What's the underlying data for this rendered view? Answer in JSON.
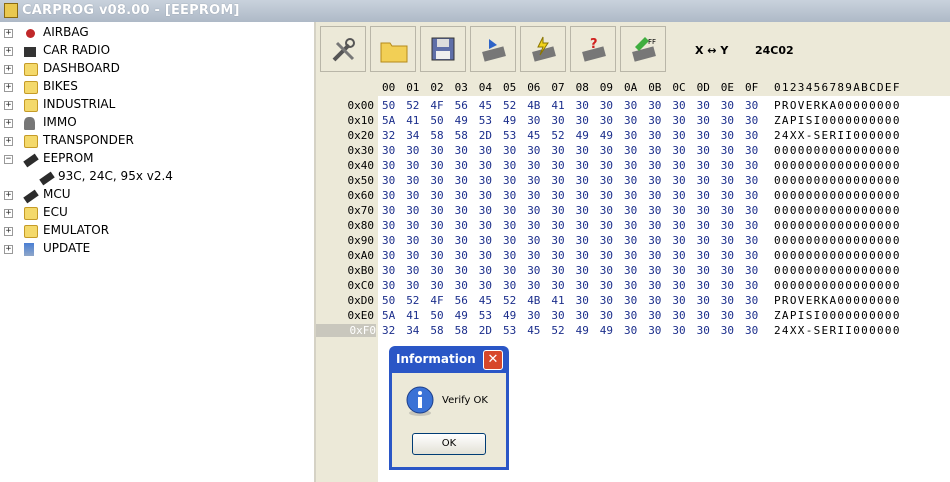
{
  "window": {
    "title": "CARPROG   v08.00 - [EEPROM]"
  },
  "tree": {
    "items": [
      {
        "label": "AIRBAG",
        "icon": "airbag-icon",
        "expand": "+"
      },
      {
        "label": "CAR RADIO",
        "icon": "radio-icon",
        "expand": "+"
      },
      {
        "label": "DASHBOARD",
        "icon": "folder-icon",
        "expand": "+"
      },
      {
        "label": "BIKES",
        "icon": "folder-icon",
        "expand": "+"
      },
      {
        "label": "INDUSTRIAL",
        "icon": "folder-icon",
        "expand": "+"
      },
      {
        "label": "IMMO",
        "icon": "immo-icon",
        "expand": "+"
      },
      {
        "label": "TRANSPONDER",
        "icon": "folder-icon",
        "expand": "+"
      },
      {
        "label": "EEPROM",
        "icon": "chip-icon",
        "expand": "−"
      },
      {
        "label": "93C, 24C, 95x v2.4",
        "icon": "chip-icon",
        "child": true
      },
      {
        "label": "MCU",
        "icon": "chip-icon",
        "expand": "+"
      },
      {
        "label": "ECU",
        "icon": "folder-icon",
        "expand": "+"
      },
      {
        "label": "EMULATOR",
        "icon": "folder-icon",
        "expand": "+"
      },
      {
        "label": "UPDATE",
        "icon": "update-icon",
        "expand": "+"
      }
    ]
  },
  "toolbar": {
    "buttons": [
      "settings-tools",
      "open-folder",
      "save-file",
      "read-chip",
      "write-chip",
      "verify-chip",
      "erase-chip"
    ],
    "swap_label": "X ↔ Y",
    "chip_label": "24C02"
  },
  "hex": {
    "columns": [
      "00",
      "01",
      "02",
      "03",
      "04",
      "05",
      "06",
      "07",
      "08",
      "09",
      "0A",
      "0B",
      "0C",
      "0D",
      "0E",
      "0F"
    ],
    "ascii_header": "0123456789ABCDEF",
    "rows": [
      {
        "addr": "0x00",
        "bytes": [
          "50",
          "52",
          "4F",
          "56",
          "45",
          "52",
          "4B",
          "41",
          "30",
          "30",
          "30",
          "30",
          "30",
          "30",
          "30",
          "30"
        ],
        "ascii": "PROVERKA00000000"
      },
      {
        "addr": "0x10",
        "bytes": [
          "5A",
          "41",
          "50",
          "49",
          "53",
          "49",
          "30",
          "30",
          "30",
          "30",
          "30",
          "30",
          "30",
          "30",
          "30",
          "30"
        ],
        "ascii": "ZAPISI0000000000"
      },
      {
        "addr": "0x20",
        "bytes": [
          "32",
          "34",
          "58",
          "58",
          "2D",
          "53",
          "45",
          "52",
          "49",
          "49",
          "30",
          "30",
          "30",
          "30",
          "30",
          "30"
        ],
        "ascii": "24XX-SERII000000"
      },
      {
        "addr": "0x30",
        "bytes": [
          "30",
          "30",
          "30",
          "30",
          "30",
          "30",
          "30",
          "30",
          "30",
          "30",
          "30",
          "30",
          "30",
          "30",
          "30",
          "30"
        ],
        "ascii": "0000000000000000"
      },
      {
        "addr": "0x40",
        "bytes": [
          "30",
          "30",
          "30",
          "30",
          "30",
          "30",
          "30",
          "30",
          "30",
          "30",
          "30",
          "30",
          "30",
          "30",
          "30",
          "30"
        ],
        "ascii": "0000000000000000"
      },
      {
        "addr": "0x50",
        "bytes": [
          "30",
          "30",
          "30",
          "30",
          "30",
          "30",
          "30",
          "30",
          "30",
          "30",
          "30",
          "30",
          "30",
          "30",
          "30",
          "30"
        ],
        "ascii": "0000000000000000"
      },
      {
        "addr": "0x60",
        "bytes": [
          "30",
          "30",
          "30",
          "30",
          "30",
          "30",
          "30",
          "30",
          "30",
          "30",
          "30",
          "30",
          "30",
          "30",
          "30",
          "30"
        ],
        "ascii": "0000000000000000"
      },
      {
        "addr": "0x70",
        "bytes": [
          "30",
          "30",
          "30",
          "30",
          "30",
          "30",
          "30",
          "30",
          "30",
          "30",
          "30",
          "30",
          "30",
          "30",
          "30",
          "30"
        ],
        "ascii": "0000000000000000"
      },
      {
        "addr": "0x80",
        "bytes": [
          "30",
          "30",
          "30",
          "30",
          "30",
          "30",
          "30",
          "30",
          "30",
          "30",
          "30",
          "30",
          "30",
          "30",
          "30",
          "30"
        ],
        "ascii": "0000000000000000"
      },
      {
        "addr": "0x90",
        "bytes": [
          "30",
          "30",
          "30",
          "30",
          "30",
          "30",
          "30",
          "30",
          "30",
          "30",
          "30",
          "30",
          "30",
          "30",
          "30",
          "30"
        ],
        "ascii": "0000000000000000"
      },
      {
        "addr": "0xA0",
        "bytes": [
          "30",
          "30",
          "30",
          "30",
          "30",
          "30",
          "30",
          "30",
          "30",
          "30",
          "30",
          "30",
          "30",
          "30",
          "30",
          "30"
        ],
        "ascii": "0000000000000000"
      },
      {
        "addr": "0xB0",
        "bytes": [
          "30",
          "30",
          "30",
          "30",
          "30",
          "30",
          "30",
          "30",
          "30",
          "30",
          "30",
          "30",
          "30",
          "30",
          "30",
          "30"
        ],
        "ascii": "0000000000000000"
      },
      {
        "addr": "0xC0",
        "bytes": [
          "30",
          "30",
          "30",
          "30",
          "30",
          "30",
          "30",
          "30",
          "30",
          "30",
          "30",
          "30",
          "30",
          "30",
          "30",
          "30"
        ],
        "ascii": "0000000000000000"
      },
      {
        "addr": "0xD0",
        "bytes": [
          "50",
          "52",
          "4F",
          "56",
          "45",
          "52",
          "4B",
          "41",
          "30",
          "30",
          "30",
          "30",
          "30",
          "30",
          "30",
          "30"
        ],
        "ascii": "PROVERKA00000000"
      },
      {
        "addr": "0xE0",
        "bytes": [
          "5A",
          "41",
          "50",
          "49",
          "53",
          "49",
          "30",
          "30",
          "30",
          "30",
          "30",
          "30",
          "30",
          "30",
          "30",
          "30"
        ],
        "ascii": "ZAPISI0000000000"
      },
      {
        "addr": "0xF0",
        "bytes": [
          "32",
          "34",
          "58",
          "58",
          "2D",
          "53",
          "45",
          "52",
          "49",
          "49",
          "30",
          "30",
          "30",
          "30",
          "30",
          "30"
        ],
        "ascii": "24XX-SERII000000"
      }
    ]
  },
  "dialog": {
    "title": "Information",
    "close": "✕",
    "message": "Verify OK",
    "ok_label": "OK"
  }
}
